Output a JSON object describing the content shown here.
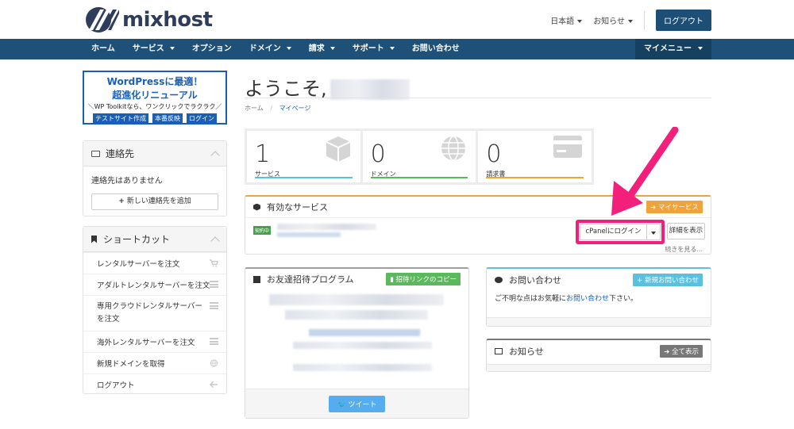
{
  "header": {
    "logo_text": "mixhost",
    "language_label": "日本語",
    "notifications_label": "お知らせ",
    "logout_label": "ログアウト"
  },
  "nav": {
    "items": [
      {
        "label": "ホーム",
        "dropdown": false
      },
      {
        "label": "サービス",
        "dropdown": true
      },
      {
        "label": "オプション",
        "dropdown": false
      },
      {
        "label": "ドメイン",
        "dropdown": true
      },
      {
        "label": "請求",
        "dropdown": true
      },
      {
        "label": "サポート",
        "dropdown": true
      },
      {
        "label": "お問い合わせ",
        "dropdown": false
      }
    ],
    "my_menu_label": "マイメニュー"
  },
  "banner": {
    "line1": "WordPressに最適！",
    "line2": "超進化リニューアル",
    "line3": "＼WP Toolkitなら、ワンクリックでラクラク／",
    "buttons": [
      "テストサイト作成",
      "本番反映",
      "ログイン"
    ]
  },
  "contacts_panel": {
    "title": "連絡先",
    "empty_text": "連絡先はありません",
    "add_button": "新しい連絡先を追加"
  },
  "shortcuts_panel": {
    "title": "ショートカット",
    "items": [
      {
        "label": "レンタルサーバーを注文",
        "icon": "cart-icon"
      },
      {
        "label": "アダルトレンタルサーバーを注文",
        "icon": "server-icon"
      },
      {
        "label": "専用クラウドレンタルサーバーを注文",
        "icon": "server-icon"
      },
      {
        "label": "海外レンタルサーバーを注文",
        "icon": "server-icon"
      },
      {
        "label": "新規ドメインを取得",
        "icon": "globe-icon"
      },
      {
        "label": "ログアウト",
        "icon": "arrow-left-icon"
      }
    ]
  },
  "main": {
    "welcome": "ようこそ,",
    "breadcrumb": [
      "ホーム",
      "マイページ"
    ]
  },
  "stats": [
    {
      "value": "1",
      "label": "サービス",
      "color": "#5bc0de",
      "icon": "cube-icon"
    },
    {
      "value": "0",
      "label": "ドメイン",
      "color": "#5cb85c",
      "icon": "globe-icon"
    },
    {
      "value": "0",
      "label": "請求書",
      "color": "#f0a33a",
      "icon": "credit-card-icon"
    }
  ],
  "services_panel": {
    "title": "有効なサービス",
    "badge": "マイサービス",
    "status_tag": "契約中",
    "cpanel_button": "cPanelにログイン",
    "detail_button": "詳細を表示",
    "more_link": "続きを見る..."
  },
  "referral_panel": {
    "title": "お友達招待プログラム",
    "badge": "招待リンクのコピー",
    "tweet_button": "ツイート"
  },
  "inquiry_panel": {
    "title": "お問い合わせ",
    "badge": "新規お問い合わせ",
    "text_before": "ご不明な点はお気軽に",
    "link": "お問い合わせ",
    "text_after": "下さい。"
  },
  "news_panel": {
    "title": "お知らせ",
    "badge": "全て表示"
  },
  "colors": {
    "nav": "#1e5078",
    "accent_pink": "#f2207a",
    "orange": "#f0a33a",
    "green": "#5cb85c",
    "cyan": "#5bc0de"
  }
}
